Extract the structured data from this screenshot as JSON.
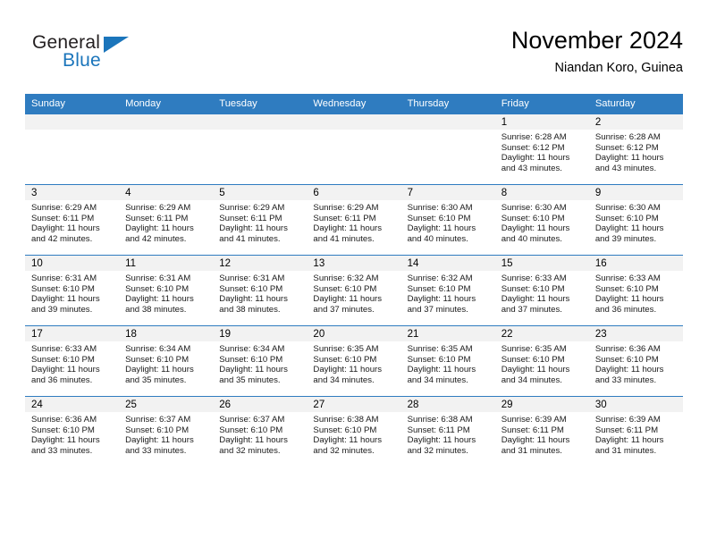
{
  "brand": {
    "name_part1": "General",
    "name_part2": "Blue",
    "triangle_color": "#1b75bb"
  },
  "header": {
    "title": "November 2024",
    "subtitle": "Niandan Koro, Guinea",
    "accent_color": "#2f7cc0",
    "band_color": "#f2f2f2"
  },
  "weekday_headers": [
    "Sunday",
    "Monday",
    "Tuesday",
    "Wednesday",
    "Thursday",
    "Friday",
    "Saturday"
  ],
  "labels": {
    "sunrise_prefix": "Sunrise:",
    "sunset_prefix": "Sunset:",
    "daylight_prefix": "Daylight:"
  },
  "weeks": [
    [
      {
        "day": "",
        "empty": true
      },
      {
        "day": "",
        "empty": true
      },
      {
        "day": "",
        "empty": true
      },
      {
        "day": "",
        "empty": true
      },
      {
        "day": "",
        "empty": true
      },
      {
        "day": "1",
        "sunrise": "Sunrise: 6:28 AM",
        "sunset": "Sunset: 6:12 PM",
        "daylight": "Daylight: 11 hours and 43 minutes."
      },
      {
        "day": "2",
        "sunrise": "Sunrise: 6:28 AM",
        "sunset": "Sunset: 6:12 PM",
        "daylight": "Daylight: 11 hours and 43 minutes."
      }
    ],
    [
      {
        "day": "3",
        "sunrise": "Sunrise: 6:29 AM",
        "sunset": "Sunset: 6:11 PM",
        "daylight": "Daylight: 11 hours and 42 minutes."
      },
      {
        "day": "4",
        "sunrise": "Sunrise: 6:29 AM",
        "sunset": "Sunset: 6:11 PM",
        "daylight": "Daylight: 11 hours and 42 minutes."
      },
      {
        "day": "5",
        "sunrise": "Sunrise: 6:29 AM",
        "sunset": "Sunset: 6:11 PM",
        "daylight": "Daylight: 11 hours and 41 minutes."
      },
      {
        "day": "6",
        "sunrise": "Sunrise: 6:29 AM",
        "sunset": "Sunset: 6:11 PM",
        "daylight": "Daylight: 11 hours and 41 minutes."
      },
      {
        "day": "7",
        "sunrise": "Sunrise: 6:30 AM",
        "sunset": "Sunset: 6:10 PM",
        "daylight": "Daylight: 11 hours and 40 minutes."
      },
      {
        "day": "8",
        "sunrise": "Sunrise: 6:30 AM",
        "sunset": "Sunset: 6:10 PM",
        "daylight": "Daylight: 11 hours and 40 minutes."
      },
      {
        "day": "9",
        "sunrise": "Sunrise: 6:30 AM",
        "sunset": "Sunset: 6:10 PM",
        "daylight": "Daylight: 11 hours and 39 minutes."
      }
    ],
    [
      {
        "day": "10",
        "sunrise": "Sunrise: 6:31 AM",
        "sunset": "Sunset: 6:10 PM",
        "daylight": "Daylight: 11 hours and 39 minutes."
      },
      {
        "day": "11",
        "sunrise": "Sunrise: 6:31 AM",
        "sunset": "Sunset: 6:10 PM",
        "daylight": "Daylight: 11 hours and 38 minutes."
      },
      {
        "day": "12",
        "sunrise": "Sunrise: 6:31 AM",
        "sunset": "Sunset: 6:10 PM",
        "daylight": "Daylight: 11 hours and 38 minutes."
      },
      {
        "day": "13",
        "sunrise": "Sunrise: 6:32 AM",
        "sunset": "Sunset: 6:10 PM",
        "daylight": "Daylight: 11 hours and 37 minutes."
      },
      {
        "day": "14",
        "sunrise": "Sunrise: 6:32 AM",
        "sunset": "Sunset: 6:10 PM",
        "daylight": "Daylight: 11 hours and 37 minutes."
      },
      {
        "day": "15",
        "sunrise": "Sunrise: 6:33 AM",
        "sunset": "Sunset: 6:10 PM",
        "daylight": "Daylight: 11 hours and 37 minutes."
      },
      {
        "day": "16",
        "sunrise": "Sunrise: 6:33 AM",
        "sunset": "Sunset: 6:10 PM",
        "daylight": "Daylight: 11 hours and 36 minutes."
      }
    ],
    [
      {
        "day": "17",
        "sunrise": "Sunrise: 6:33 AM",
        "sunset": "Sunset: 6:10 PM",
        "daylight": "Daylight: 11 hours and 36 minutes."
      },
      {
        "day": "18",
        "sunrise": "Sunrise: 6:34 AM",
        "sunset": "Sunset: 6:10 PM",
        "daylight": "Daylight: 11 hours and 35 minutes."
      },
      {
        "day": "19",
        "sunrise": "Sunrise: 6:34 AM",
        "sunset": "Sunset: 6:10 PM",
        "daylight": "Daylight: 11 hours and 35 minutes."
      },
      {
        "day": "20",
        "sunrise": "Sunrise: 6:35 AM",
        "sunset": "Sunset: 6:10 PM",
        "daylight": "Daylight: 11 hours and 34 minutes."
      },
      {
        "day": "21",
        "sunrise": "Sunrise: 6:35 AM",
        "sunset": "Sunset: 6:10 PM",
        "daylight": "Daylight: 11 hours and 34 minutes."
      },
      {
        "day": "22",
        "sunrise": "Sunrise: 6:35 AM",
        "sunset": "Sunset: 6:10 PM",
        "daylight": "Daylight: 11 hours and 34 minutes."
      },
      {
        "day": "23",
        "sunrise": "Sunrise: 6:36 AM",
        "sunset": "Sunset: 6:10 PM",
        "daylight": "Daylight: 11 hours and 33 minutes."
      }
    ],
    [
      {
        "day": "24",
        "sunrise": "Sunrise: 6:36 AM",
        "sunset": "Sunset: 6:10 PM",
        "daylight": "Daylight: 11 hours and 33 minutes."
      },
      {
        "day": "25",
        "sunrise": "Sunrise: 6:37 AM",
        "sunset": "Sunset: 6:10 PM",
        "daylight": "Daylight: 11 hours and 33 minutes."
      },
      {
        "day": "26",
        "sunrise": "Sunrise: 6:37 AM",
        "sunset": "Sunset: 6:10 PM",
        "daylight": "Daylight: 11 hours and 32 minutes."
      },
      {
        "day": "27",
        "sunrise": "Sunrise: 6:38 AM",
        "sunset": "Sunset: 6:10 PM",
        "daylight": "Daylight: 11 hours and 32 minutes."
      },
      {
        "day": "28",
        "sunrise": "Sunrise: 6:38 AM",
        "sunset": "Sunset: 6:11 PM",
        "daylight": "Daylight: 11 hours and 32 minutes."
      },
      {
        "day": "29",
        "sunrise": "Sunrise: 6:39 AM",
        "sunset": "Sunset: 6:11 PM",
        "daylight": "Daylight: 11 hours and 31 minutes."
      },
      {
        "day": "30",
        "sunrise": "Sunrise: 6:39 AM",
        "sunset": "Sunset: 6:11 PM",
        "daylight": "Daylight: 11 hours and 31 minutes."
      }
    ]
  ]
}
